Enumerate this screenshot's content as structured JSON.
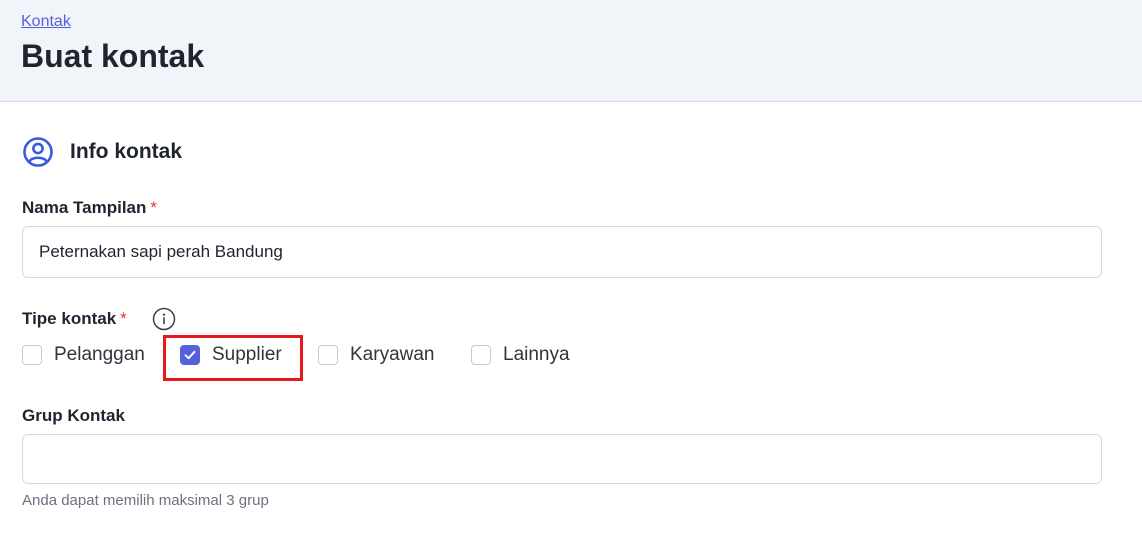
{
  "breadcrumb": {
    "label": "Kontak"
  },
  "page": {
    "title": "Buat kontak"
  },
  "section": {
    "title": "Info kontak",
    "icon": "user-circle-icon"
  },
  "display_name": {
    "label": "Nama Tampilan",
    "required_mark": "*",
    "value": "Peternakan sapi perah Bandung"
  },
  "contact_type": {
    "label": "Tipe kontak",
    "required_mark": "*",
    "info_icon": "info-icon",
    "options": [
      {
        "label": "Pelanggan",
        "checked": false
      },
      {
        "label": "Supplier",
        "checked": true
      },
      {
        "label": "Karyawan",
        "checked": false
      },
      {
        "label": "Lainnya",
        "checked": false
      }
    ]
  },
  "contact_group": {
    "label": "Grup Kontak",
    "value": "",
    "helper": "Anda dapat memilih maksimal 3 grup"
  },
  "colors": {
    "accent": "#5561d8",
    "required": "#e0343a",
    "highlight": "#e8161d",
    "header_bg": "#f1f5f9"
  }
}
